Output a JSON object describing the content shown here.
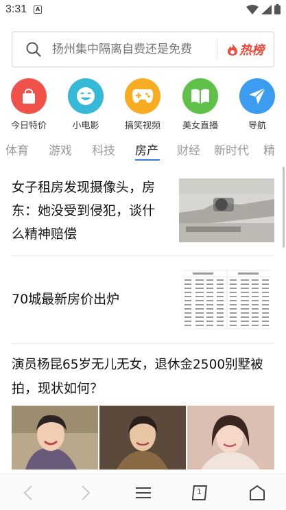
{
  "status_bar": {
    "time": "3:31",
    "notification_letter": "A"
  },
  "search": {
    "placeholder": "扬州集中隔离自费还是免费",
    "hot_label": "热榜"
  },
  "quick_links": [
    {
      "label": "今日特价",
      "icon": "shopping-bag-icon",
      "color": "#f0524a"
    },
    {
      "label": "小电影",
      "icon": "smiley-face-icon",
      "color": "#35b9d6"
    },
    {
      "label": "搞笑视频",
      "icon": "gamepad-icon",
      "color": "#f7ac22"
    },
    {
      "label": "美女直播",
      "icon": "open-book-icon",
      "color": "#5fc04a"
    },
    {
      "label": "导航",
      "icon": "paper-plane-icon",
      "color": "#3c9cf0"
    }
  ],
  "tabs": [
    "体育",
    "游戏",
    "科技",
    "房产",
    "财经",
    "新时代",
    "精"
  ],
  "active_tab": "房产",
  "news": [
    {
      "title_line1": "女子租房发现摄像头，房",
      "title_line2": "东：她没受到侵犯，谈什",
      "title_line3": "么精神赔偿"
    },
    {
      "title": "70城最新房价出炉"
    },
    {
      "title_line1": "演员杨昆65岁无儿无女，退休金2500别墅被",
      "title_line2": "拍，现状如何？"
    }
  ],
  "bottom_nav": {
    "back": "back-arrow-icon",
    "forward": "forward-arrow-icon",
    "menu": "menu-icon",
    "tabs_count": "1",
    "home": "home-icon"
  }
}
